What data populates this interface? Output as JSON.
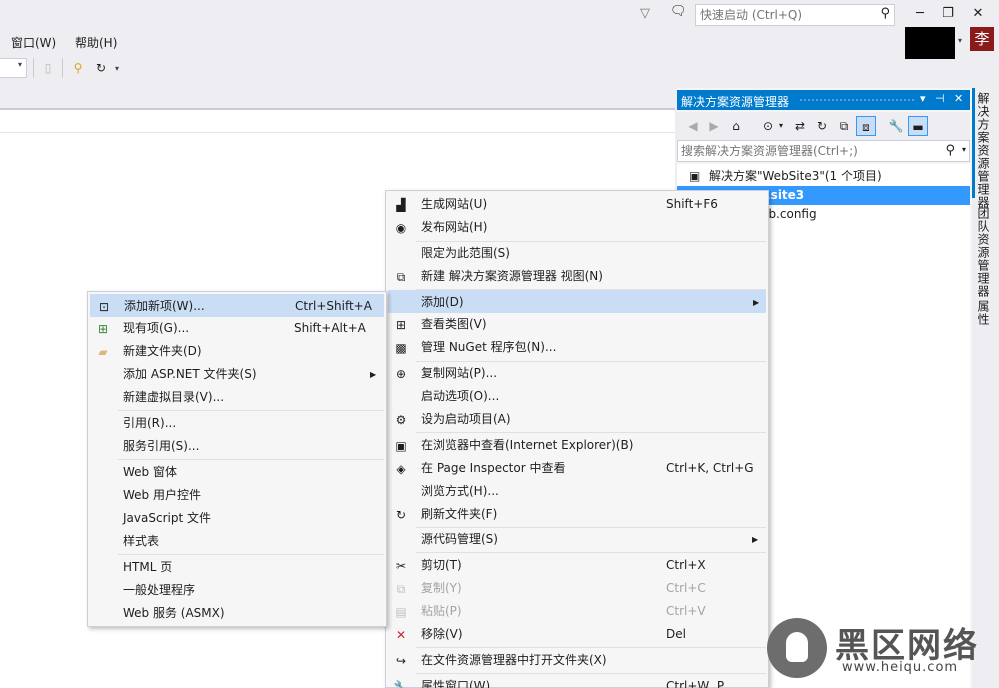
{
  "titlebar": {
    "quick_launch_placeholder": "快速启动 (Ctrl+Q)",
    "user_avatar_char": "李"
  },
  "menubar": {
    "items": [
      "窗口(W)",
      "帮助(H)"
    ]
  },
  "solution_explorer": {
    "title": "解决方案资源管理器",
    "search_placeholder": "搜索解决方案资源管理器(Ctrl+;)",
    "tree": [
      {
        "label": "解决方案\"WebSite3\"(1 个项目)",
        "selected": false
      },
      {
        "label": "...site3",
        "selected": true
      },
      {
        "label": "...b.config",
        "selected": false
      }
    ]
  },
  "side_tabs": [
    "解决方案资源管理器",
    "团队资源管理器",
    "属性"
  ],
  "context_menu": {
    "items": [
      {
        "label": "生成网站(U)",
        "shortcut": "Shift+F6",
        "icon": "build-icon"
      },
      {
        "label": "发布网站(H)",
        "shortcut": "",
        "icon": "publish-icon"
      },
      {
        "label": "限定为此范围(S)",
        "shortcut": "",
        "icon": ""
      },
      {
        "label": "新建 解决方案资源管理器 视图(N)",
        "shortcut": "",
        "icon": "new-view-icon"
      },
      {
        "label": "添加(D)",
        "shortcut": "",
        "icon": "",
        "submenu": true,
        "highlighted": true
      },
      {
        "label": "查看类图(V)",
        "shortcut": "",
        "icon": "class-diagram-icon"
      },
      {
        "label": "管理 NuGet 程序包(N)...",
        "shortcut": "",
        "icon": "nuget-icon"
      },
      {
        "label": "复制网站(P)...",
        "shortcut": "",
        "icon": "copy-website-icon"
      },
      {
        "label": "启动选项(O)...",
        "shortcut": "",
        "icon": ""
      },
      {
        "label": "设为启动项目(A)",
        "shortcut": "",
        "icon": "gear-icon"
      },
      {
        "label": "在浏览器中查看(Internet Explorer)(B)",
        "shortcut": "",
        "icon": "browser-icon"
      },
      {
        "label": "在 Page Inspector 中查看",
        "shortcut": "Ctrl+K, Ctrl+G",
        "icon": "page-inspector-icon"
      },
      {
        "label": "浏览方式(H)...",
        "shortcut": "",
        "icon": ""
      },
      {
        "label": "刷新文件夹(F)",
        "shortcut": "",
        "icon": "refresh-icon"
      },
      {
        "label": "源代码管理(S)",
        "shortcut": "",
        "icon": "",
        "submenu": true
      },
      {
        "label": "剪切(T)",
        "shortcut": "Ctrl+X",
        "icon": "scissors-icon"
      },
      {
        "label": "复制(Y)",
        "shortcut": "Ctrl+C",
        "icon": "copy-icon",
        "disabled": true
      },
      {
        "label": "粘贴(P)",
        "shortcut": "Ctrl+V",
        "icon": "paste-icon",
        "disabled": true
      },
      {
        "label": "移除(V)",
        "shortcut": "Del",
        "icon": "remove-icon"
      },
      {
        "label": "在文件资源管理器中打开文件夹(X)",
        "shortcut": "",
        "icon": "open-folder-icon"
      },
      {
        "label": "属性窗口(W)",
        "shortcut": "Ctrl+W, P",
        "icon": "properties-icon"
      }
    ]
  },
  "add_submenu": {
    "items": [
      {
        "label": "添加新项(W)...",
        "shortcut": "Ctrl+Shift+A",
        "icon": "add-new-item-icon",
        "highlighted": true
      },
      {
        "label": "现有项(G)...",
        "shortcut": "Shift+Alt+A",
        "icon": "add-existing-item-icon"
      },
      {
        "label": "新建文件夹(D)",
        "shortcut": "",
        "icon": "new-folder-icon"
      },
      {
        "label": "添加 ASP.NET 文件夹(S)",
        "shortcut": "",
        "icon": "",
        "submenu": true
      },
      {
        "label": "新建虚拟目录(V)...",
        "shortcut": "",
        "icon": ""
      },
      {
        "label": "引用(R)...",
        "shortcut": "",
        "icon": ""
      },
      {
        "label": "服务引用(S)...",
        "shortcut": "",
        "icon": ""
      },
      {
        "label": "Web 窗体",
        "shortcut": "",
        "icon": ""
      },
      {
        "label": "Web 用户控件",
        "shortcut": "",
        "icon": ""
      },
      {
        "label": "JavaScript 文件",
        "shortcut": "",
        "icon": ""
      },
      {
        "label": "样式表",
        "shortcut": "",
        "icon": ""
      },
      {
        "label": "HTML 页",
        "shortcut": "",
        "icon": ""
      },
      {
        "label": "一般处理程序",
        "shortcut": "",
        "icon": ""
      },
      {
        "label": "Web 服务 (ASMX)",
        "shortcut": "",
        "icon": ""
      }
    ]
  },
  "watermark": {
    "text": "黑区网络",
    "url": "www.heiqu.com"
  },
  "colors": {
    "accent": "#007acc",
    "highlight": "#c9def5",
    "selection": "#3399ff"
  }
}
